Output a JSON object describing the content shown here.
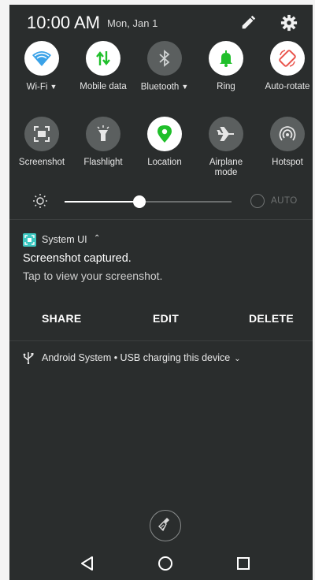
{
  "status": {
    "time": "10:00 AM",
    "date": "Mon, Jan 1",
    "edit_icon": "pencil-icon",
    "settings_icon": "gear-icon"
  },
  "tiles": [
    {
      "label": "Wi-Fi",
      "icon": "wifi-icon",
      "state": "on",
      "caret": true
    },
    {
      "label": "Mobile data",
      "icon": "mobile-data-icon",
      "state": "on",
      "caret": false
    },
    {
      "label": "Bluetooth",
      "icon": "bluetooth-icon",
      "state": "off",
      "caret": true
    },
    {
      "label": "Ring",
      "icon": "bell-icon",
      "state": "on",
      "caret": false
    },
    {
      "label": "Auto-rotate",
      "icon": "rotate-icon",
      "state": "on",
      "caret": false
    },
    {
      "label": "Screenshot",
      "icon": "screenshot-icon",
      "state": "off",
      "caret": false
    },
    {
      "label": "Flashlight",
      "icon": "flashlight-icon",
      "state": "off",
      "caret": false
    },
    {
      "label": "Location",
      "icon": "location-icon",
      "state": "on",
      "caret": false
    },
    {
      "label": "Airplane\nmode",
      "icon": "airplane-icon",
      "state": "off",
      "caret": false
    },
    {
      "label": "Hotspot",
      "icon": "hotspot-icon",
      "state": "off",
      "caret": false
    }
  ],
  "brightness": {
    "level": 0.45,
    "auto_label": "AUTO",
    "auto_enabled": false
  },
  "notification": {
    "app_name": "System UI",
    "title": "Screenshot captured.",
    "body": "Tap to view your screenshot.",
    "actions": [
      "SHARE",
      "EDIT",
      "DELETE"
    ]
  },
  "usb_notification": {
    "text": "Android System • USB charging this device"
  },
  "colors": {
    "panel_bg": "#2a2d2d",
    "tile_on": "#ffffff",
    "tile_off": "#5b5f5f",
    "active_green": "#1fbf2a",
    "rotate_red": "#e9524a",
    "wifi_blue": "#3aa2e8",
    "accent_teal": "#3cc7c0"
  },
  "nav": {
    "back_icon": "back-triangle-icon",
    "home_icon": "home-circle-icon",
    "recents_icon": "recents-square-icon",
    "clear_icon": "clear-all-broom-icon"
  }
}
